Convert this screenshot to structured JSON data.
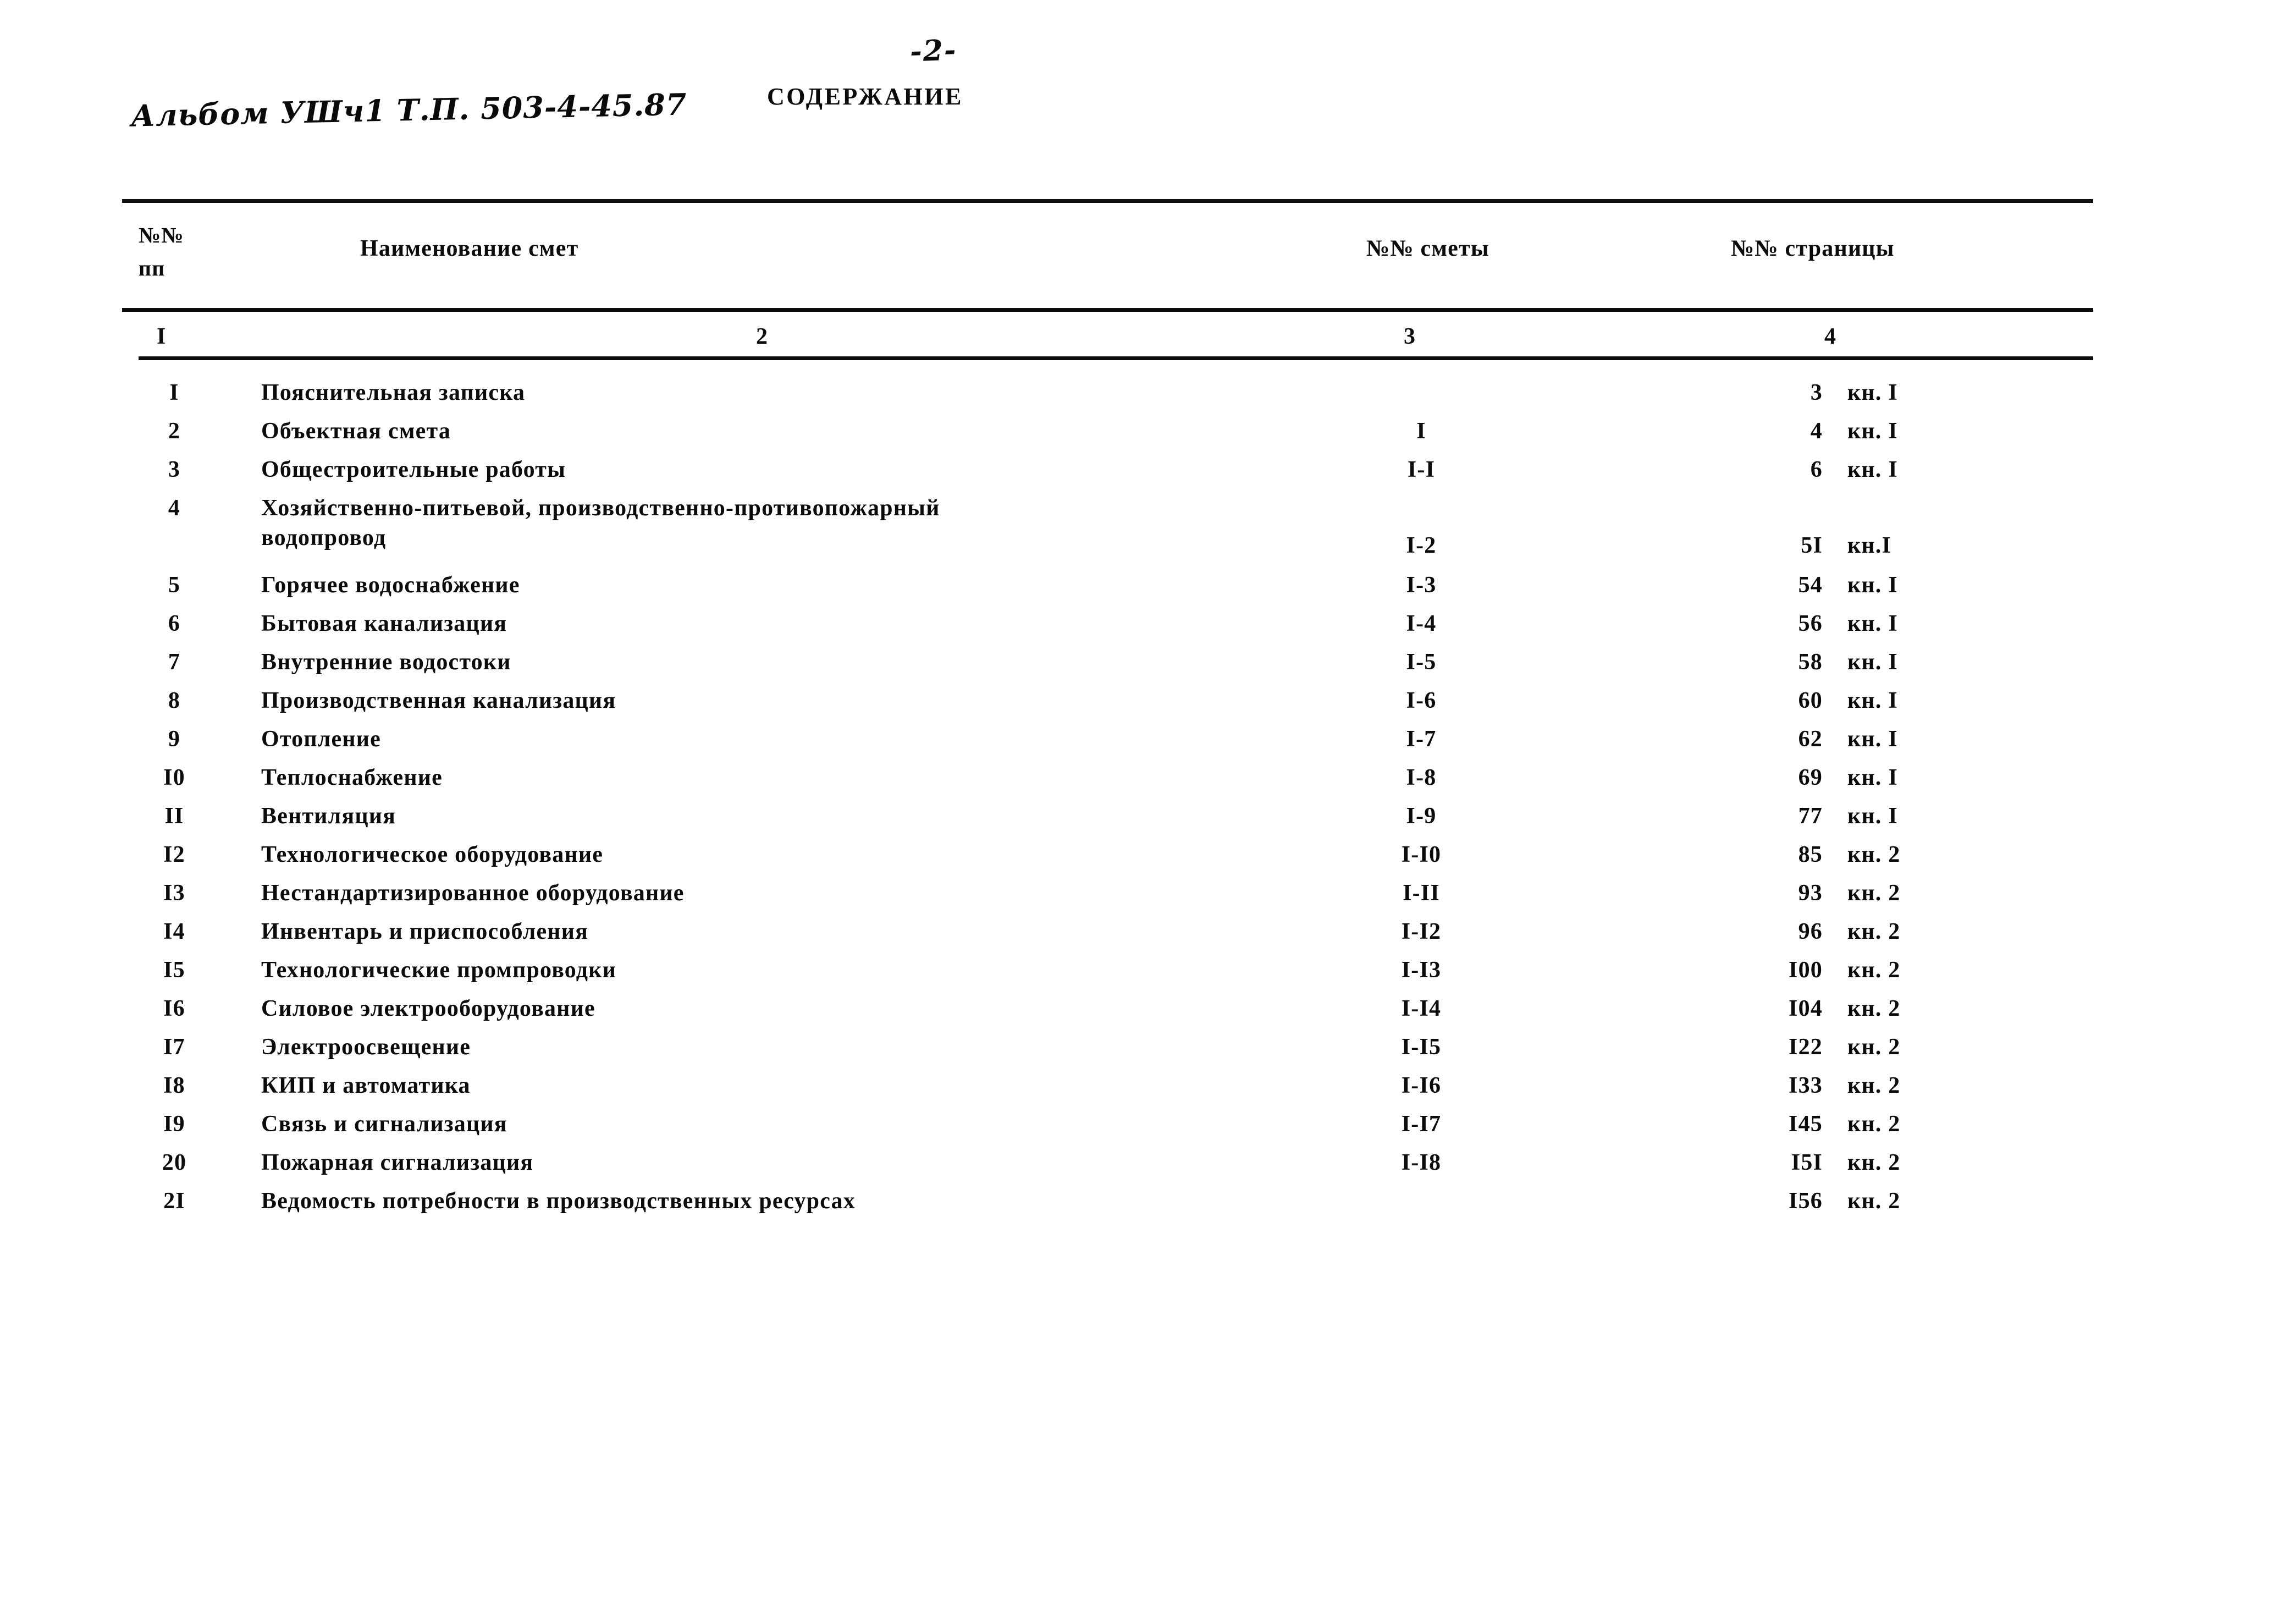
{
  "page": {
    "page_mark": "-2-",
    "album_reference": "Альбом УШч1 Т.П. 503-4-45.87",
    "title": "СОДЕРЖАНИЕ"
  },
  "table": {
    "headers": {
      "col1": {
        "line1": "№№",
        "line2": "пп"
      },
      "col2": "Наименование смет",
      "col3": "№№ сметы",
      "col4": "№№ страницы"
    },
    "column_numbers": [
      "I",
      "2",
      "3",
      "4"
    ],
    "rows": [
      {
        "num": "I",
        "name": "Пояснительная записка",
        "name2": "",
        "smeta": "",
        "page": "3",
        "book": "кн. I"
      },
      {
        "num": "2",
        "name": "Объектная смета",
        "name2": "",
        "smeta": "I",
        "page": "4",
        "book": "кн. I"
      },
      {
        "num": "3",
        "name": "Общестроительные работы",
        "name2": "",
        "smeta": "I-I",
        "page": "6",
        "book": "кн. I"
      },
      {
        "num": "4",
        "name": "Хозяйственно-питьевой, производственно-противопожарный",
        "name2": "водопровод",
        "smeta": "I-2",
        "page": "5I",
        "book": "кн.I"
      },
      {
        "num": "5",
        "name": "Горячее водоснабжение",
        "name2": "",
        "smeta": "I-3",
        "page": "54",
        "book": "кн. I"
      },
      {
        "num": "6",
        "name": "Бытовая канализация",
        "name2": "",
        "smeta": "I-4",
        "page": "56",
        "book": "кн. I"
      },
      {
        "num": "7",
        "name": "Внутренние водостоки",
        "name2": "",
        "smeta": "I-5",
        "page": "58",
        "book": "кн. I"
      },
      {
        "num": "8",
        "name": "Производственная канализация",
        "name2": "",
        "smeta": "I-6",
        "page": "60",
        "book": "кн. I"
      },
      {
        "num": "9",
        "name": "Отопление",
        "name2": "",
        "smeta": "I-7",
        "page": "62",
        "book": "кн. I"
      },
      {
        "num": "I0",
        "name": "Теплоснабжение",
        "name2": "",
        "smeta": "I-8",
        "page": "69",
        "book": "кн. I"
      },
      {
        "num": "II",
        "name": "Вентиляция",
        "name2": "",
        "smeta": "I-9",
        "page": "77",
        "book": "кн. I"
      },
      {
        "num": "I2",
        "name": "Технологическое оборудование",
        "name2": "",
        "smeta": "I-I0",
        "page": "85",
        "book": "кн. 2"
      },
      {
        "num": "I3",
        "name": "Нестандартизированное оборудование",
        "name2": "",
        "smeta": "I-II",
        "page": "93",
        "book": "кн. 2"
      },
      {
        "num": "I4",
        "name": "Инвентарь и приспособления",
        "name2": "",
        "smeta": "I-I2",
        "page": "96",
        "book": "кн. 2"
      },
      {
        "num": "I5",
        "name": "Технологические промпроводки",
        "name2": "",
        "smeta": "I-I3",
        "page": "I00",
        "book": "кн. 2"
      },
      {
        "num": "I6",
        "name": "Силовое электрооборудование",
        "name2": "",
        "smeta": "I-I4",
        "page": "I04",
        "book": "кн. 2"
      },
      {
        "num": "I7",
        "name": "Электроосвещение",
        "name2": "",
        "smeta": "I-I5",
        "page": "I22",
        "book": "кн. 2"
      },
      {
        "num": "I8",
        "name": "КИП и автоматика",
        "name2": "",
        "smeta": "I-I6",
        "page": "I33",
        "book": "кн. 2"
      },
      {
        "num": "I9",
        "name": "Связь и сигнализация",
        "name2": "",
        "smeta": "I-I7",
        "page": "I45",
        "book": "кн. 2"
      },
      {
        "num": "20",
        "name": "Пожарная сигнализация",
        "name2": "",
        "smeta": "I-I8",
        "page": "I5I",
        "book": "кн. 2"
      },
      {
        "num": "2I",
        "name": "Ведомость потребности в  производственных   ресурсах",
        "name2": "",
        "smeta": "",
        "page": "I56",
        "book": "кн. 2"
      }
    ]
  }
}
